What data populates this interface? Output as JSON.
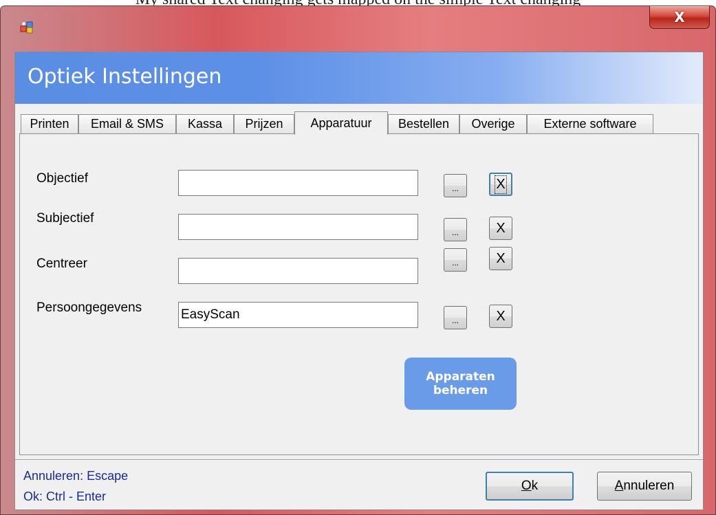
{
  "background_text": "My shared Text changing gets mapped on the simple Text changing",
  "window": {
    "close_glyph": "X",
    "header_title": "Optiek Instellingen"
  },
  "tabs": [
    {
      "label": "Printen"
    },
    {
      "label": "Email & SMS"
    },
    {
      "label": "Kassa"
    },
    {
      "label": "Prijzen"
    },
    {
      "label": "Apparatuur",
      "active": true
    },
    {
      "label": "Bestellen"
    },
    {
      "label": "Overige"
    },
    {
      "label": "Externe software"
    }
  ],
  "devices": [
    {
      "label": "Objectief",
      "value": "",
      "browse": "...",
      "clear": "X"
    },
    {
      "label": "Subjectief",
      "value": "",
      "browse": "...",
      "clear": "X"
    },
    {
      "label": "Centreer",
      "value": "",
      "browse": "...",
      "clear": "X"
    },
    {
      "label": "Persoongegevens",
      "value": "EasyScan",
      "browse": "...",
      "clear": "X"
    }
  ],
  "manage_button": {
    "line1": "Apparaten",
    "line2": "beheren"
  },
  "shortcuts": {
    "cancel": "Annuleren: Escape",
    "ok": "Ok: Ctrl - Enter"
  },
  "buttons": {
    "ok_first": "O",
    "ok_rest": "k",
    "cancel_first": "A",
    "cancel_rest": "nnuleren"
  },
  "colors": {
    "header_band": "#5a8ee3",
    "primary_button": "#6a9be8",
    "shortcut_text": "#1a2a9c",
    "titlebar": "#d7585c"
  },
  "icons": {
    "app": "app-icon",
    "close": "close-icon"
  }
}
